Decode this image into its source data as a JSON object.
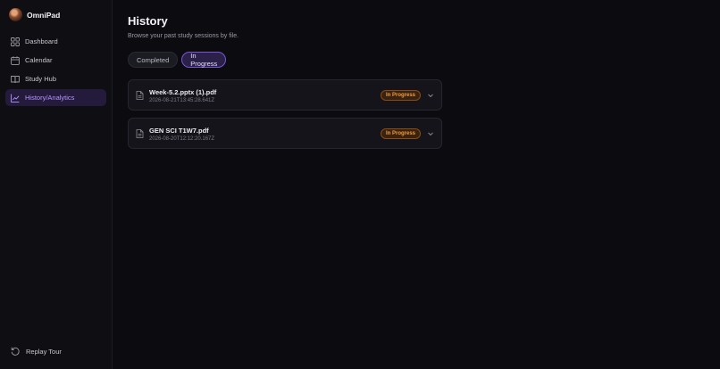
{
  "app": {
    "name": "OmniPad"
  },
  "sidebar": {
    "items": [
      {
        "label": "Dashboard",
        "icon": "dashboard-icon"
      },
      {
        "label": "Calendar",
        "icon": "calendar-icon"
      },
      {
        "label": "Study Hub",
        "icon": "book-icon"
      },
      {
        "label": "History/Analytics",
        "icon": "chart-line-icon",
        "active": true
      }
    ],
    "footer": {
      "label": "Replay Tour",
      "icon": "replay-icon"
    }
  },
  "main": {
    "title": "History",
    "subtitle": "Browse your past study sessions by file.",
    "tabs": [
      {
        "label": "Completed",
        "active": false
      },
      {
        "label": "In Progress",
        "active": true
      }
    ],
    "sessions": [
      {
        "file": "Week-5.2.pptx (1).pdf",
        "timestamp": "2026-08-21T13:45:28.641Z",
        "status": "In Progress"
      },
      {
        "file": "GEN SCI T1W7.pdf",
        "timestamp": "2026-08-20T12:12:20.167Z",
        "status": "In Progress"
      }
    ]
  },
  "colors": {
    "accent": "#b896ff",
    "active_bg": "#241a3c",
    "badge_text": "#f39a3a",
    "background": "#0c0c10"
  }
}
